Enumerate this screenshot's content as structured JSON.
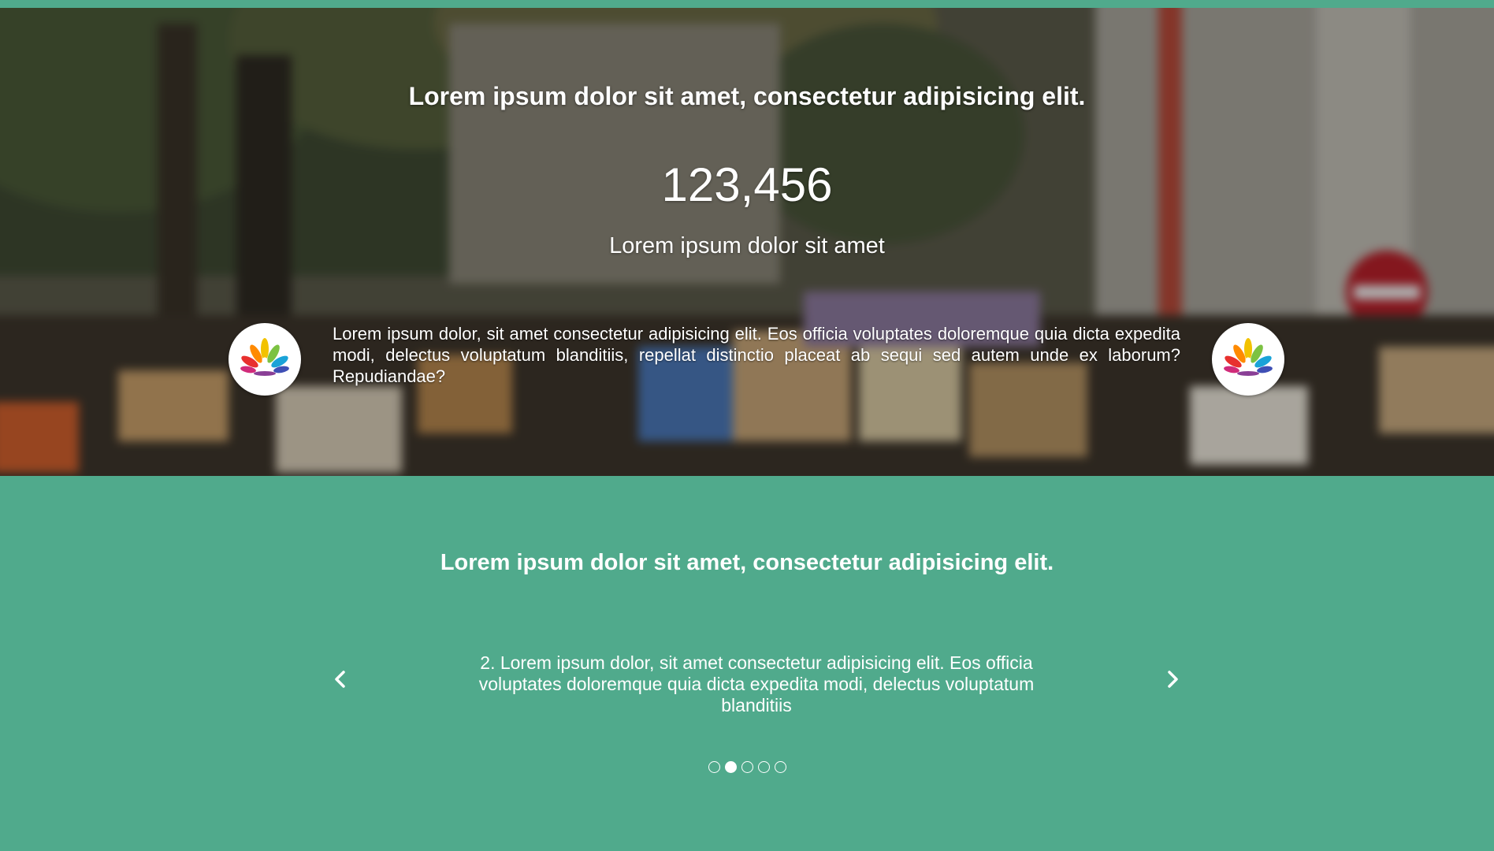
{
  "colors": {
    "accent": "#50aa8c",
    "text": "#ffffff"
  },
  "hero": {
    "heading": "Lorem ipsum dolor sit amet, consectetur adipisicing elit.",
    "counter": "123,456",
    "subtitle": "Lorem ipsum dolor sit amet",
    "paragraph": "Lorem ipsum dolor, sit amet consectetur adipisicing elit. Eos officia voluptates doloremque quia dicta expedita modi, delectus voluptatum blanditiis, repellat distinctio placeat ab sequi sed autem unde ex laborum? Repudiandae?",
    "logo_icon": "lotus-meditation-logo-icon",
    "background": "blurred-street-protest-photo"
  },
  "testimonial": {
    "heading": "Lorem ipsum dolor sit amet, consectetur adipisicing elit.",
    "slide_text": "2. Lorem ipsum dolor, sit amet consectetur adipisicing elit. Eos officia voluptates doloremque quia dicta expedita modi, delectus voluptatum blanditiis",
    "prev_icon": "chevron-left-icon",
    "next_icon": "chevron-right-icon",
    "slide_count": 5,
    "active_slide": 2
  }
}
